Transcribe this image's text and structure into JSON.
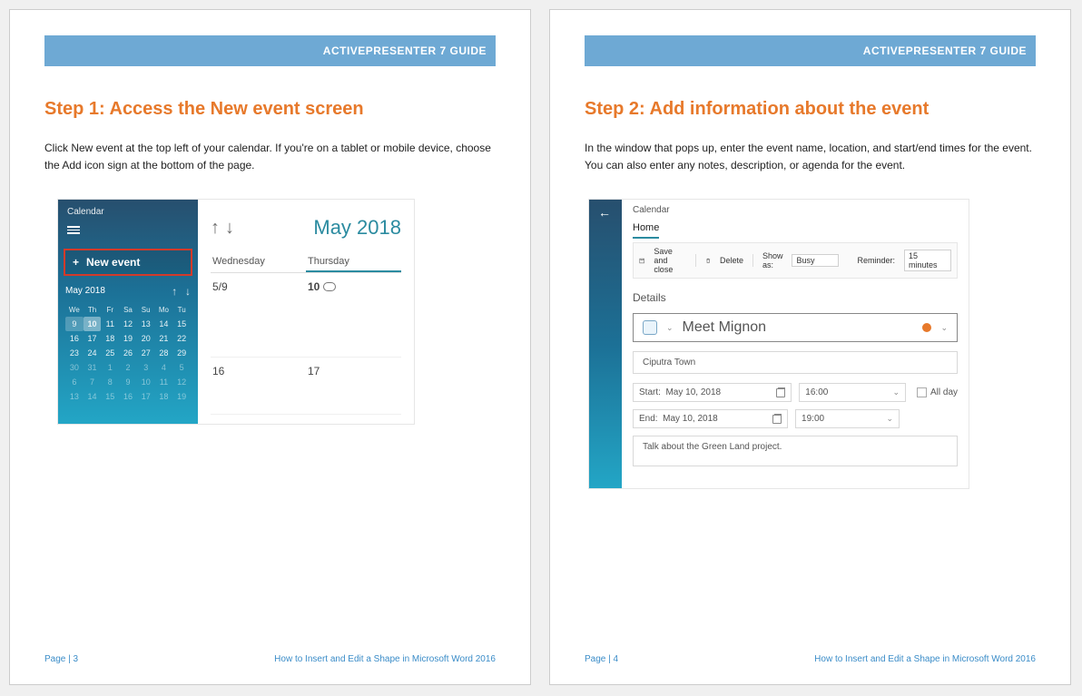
{
  "banner": "ACTIVEPRESENTER 7 GUIDE",
  "footer_doc": "How to Insert and Edit a Shape in Microsoft Word 2016",
  "page1": {
    "heading": "Step 1: Access the New event screen",
    "body": "Click New event at the top left of your calendar. If you're on a tablet or mobile device, choose the  Add icon sign at the bottom of the page.",
    "page_num": "Page | 3",
    "cal": {
      "title": "Calendar",
      "new_event": "New event",
      "mini_label": "May 2018",
      "dow": [
        "We",
        "Th",
        "Fr",
        "Sa",
        "Su",
        "Mo",
        "Tu"
      ],
      "rows": [
        [
          "9",
          "10",
          "11",
          "12",
          "13",
          "14",
          "15"
        ],
        [
          "16",
          "17",
          "18",
          "19",
          "20",
          "21",
          "22"
        ],
        [
          "23",
          "24",
          "25",
          "26",
          "27",
          "28",
          "29"
        ],
        [
          "30",
          "31",
          "1",
          "2",
          "3",
          "4",
          "5"
        ],
        [
          "6",
          "7",
          "8",
          "9",
          "10",
          "11",
          "12"
        ],
        [
          "13",
          "14",
          "15",
          "16",
          "17",
          "18",
          "19"
        ]
      ],
      "big_month": "May 2018",
      "wed": "Wednesday",
      "thu": "Thursday",
      "r1a": "5/9",
      "r1b": "10",
      "r2a": "16",
      "r2b": "17"
    }
  },
  "page2": {
    "heading": "Step 2: Add information about the event",
    "body": "In the window that pops up, enter the event name, location, and start/end times for the event. You can also enter any notes, description, or agenda for the event.",
    "page_num": "Page | 4",
    "ev": {
      "app_title": "Calendar",
      "tab": "Home",
      "save": "Save and close",
      "delete": "Delete",
      "showas_lbl": "Show as:",
      "showas_val": "Busy",
      "reminder_lbl": "Reminder:",
      "reminder_val": "15 minutes",
      "details": "Details",
      "event_name": "Meet Mignon",
      "location": "Ciputra Town",
      "start_lbl": "Start:",
      "start_date": "May 10, 2018",
      "start_time": "16:00",
      "end_lbl": "End:",
      "end_date": "May 10, 2018",
      "end_time": "19:00",
      "all_day": "All day",
      "notes": "Talk about the Green Land project."
    }
  }
}
